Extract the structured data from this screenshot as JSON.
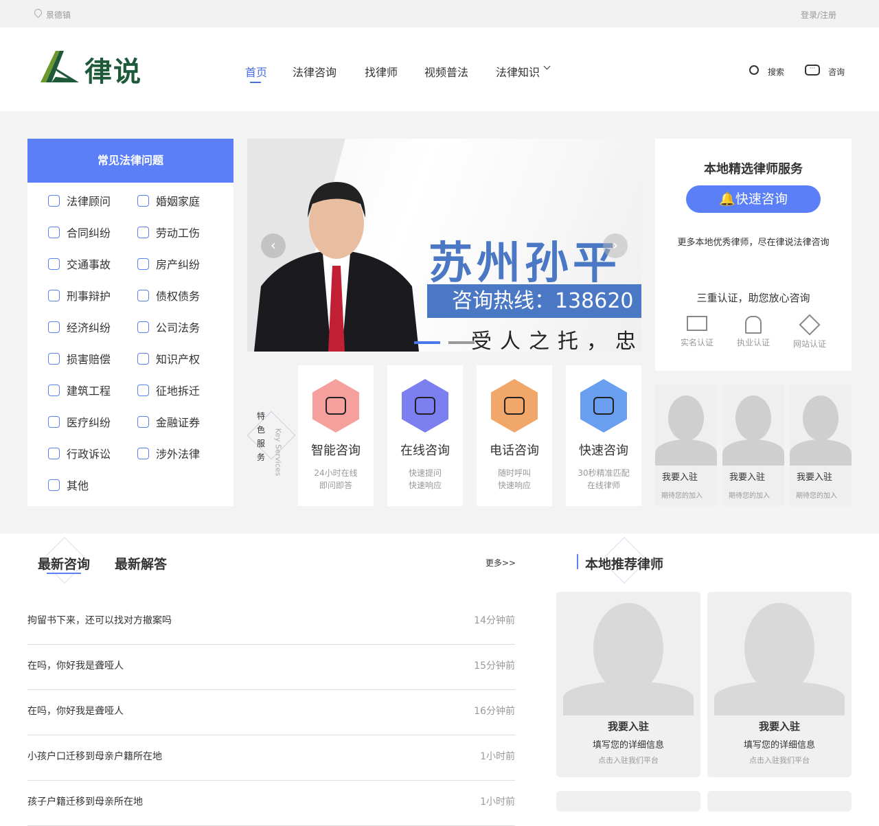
{
  "topbar": {
    "location": "景德镇",
    "login": "登录/注册"
  },
  "header": {
    "logo_text": "律说",
    "nav": [
      {
        "label": "首页",
        "active": true
      },
      {
        "label": "法律咨询"
      },
      {
        "label": "找律师"
      },
      {
        "label": "视频普法"
      },
      {
        "label": "法律知识"
      }
    ],
    "search": "搜索",
    "consult": "咨询"
  },
  "colors": {
    "accent": "#5b7ff7",
    "logo_green": "#1e5a3a"
  },
  "left_panel": {
    "title": "常见法律问题",
    "items": [
      "法律顾问",
      "婚姻家庭",
      "合同纠纷",
      "劳动工伤",
      "交通事故",
      "房产纠纷",
      "刑事辩护",
      "债权债务",
      "经济纠纷",
      "公司法务",
      "损害赔偿",
      "知识产权",
      "建筑工程",
      "征地拆迁",
      "医疗纠纷",
      "金融证券",
      "行政诉讼",
      "涉外法律",
      "其他"
    ]
  },
  "banner": {
    "name": "苏州孙平",
    "hotline": "咨询热线：138620",
    "slogan": "受人之托，忠人",
    "slide_index": 1,
    "slide_count": 2
  },
  "services": {
    "label_cn": "特色服务",
    "label_en": "Key Services",
    "items": [
      {
        "title": "智能咨询",
        "sub": [
          "24小时在线",
          "即问即答"
        ],
        "color": "#f5a09c",
        "icon": "headset-icon"
      },
      {
        "title": "在线咨询",
        "sub": [
          "快速提问",
          "快速响应"
        ],
        "color": "#7b7ff0",
        "icon": "grid-search-icon"
      },
      {
        "title": "电话咨询",
        "sub": [
          "随时呼叫",
          "快速响应"
        ],
        "color": "#f2a76a",
        "icon": "phone-icon"
      },
      {
        "title": "快速咨询",
        "sub": [
          "30秒精准匹配",
          "在线律师"
        ],
        "color": "#6a9ff0",
        "icon": "message-icon"
      }
    ]
  },
  "right_panel": {
    "title": "本地精选律师服务",
    "button": "快速咨询",
    "desc": "更多本地优秀律师，尽在律说法律咨询",
    "cert_title": "三重认证，助您放心咨询",
    "certs": [
      "实名认证",
      "执业认证",
      "网站认证"
    ]
  },
  "join_small": [
    {
      "title": "我要入驻",
      "sub": "期待您的加入"
    },
    {
      "title": "我要入驻",
      "sub": "期待您的加入"
    },
    {
      "title": "我要入驻",
      "sub": "期待您的加入"
    }
  ],
  "news": {
    "tabs": [
      "最新咨询",
      "最新解答"
    ],
    "more": "更多>>",
    "rows": [
      {
        "q": "拘留书下来，还可以找对方撤案吗",
        "t": "14分钟前"
      },
      {
        "q": "在吗，你好我是聋哑人",
        "t": "15分钟前"
      },
      {
        "q": "在吗，你好我是聋哑人",
        "t": "16分钟前"
      },
      {
        "q": "小孩户口迁移到母亲户籍所在地",
        "t": "1小时前"
      },
      {
        "q": "孩子户籍迁移到母亲所在地",
        "t": "1小时前"
      }
    ]
  },
  "recommend": {
    "title": "本地推荐律师",
    "cards": [
      {
        "title": "我要入驻",
        "line1": "填写您的详细信息",
        "line2": "点击入驻我们平台"
      },
      {
        "title": "我要入驻",
        "line1": "填写您的详细信息",
        "line2": "点击入驻我们平台"
      }
    ]
  }
}
